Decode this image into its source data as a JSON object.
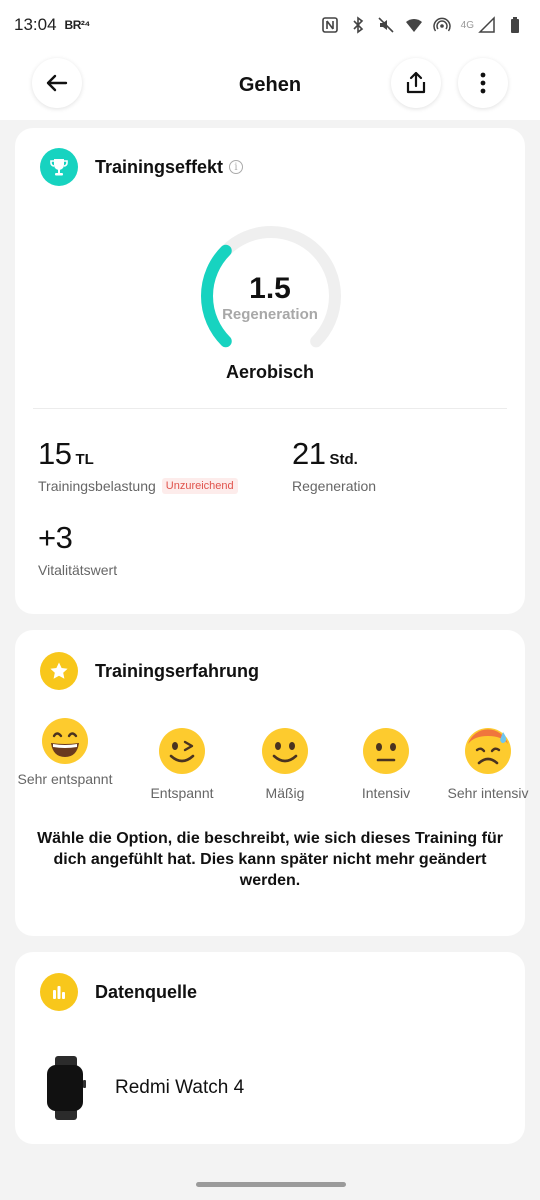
{
  "status_bar": {
    "time": "13:04",
    "carrier_icon_text": "BR²⁴",
    "network": "4G",
    "icons": [
      "nfc-icon",
      "bluetooth-icon",
      "mute-icon",
      "wifi-icon",
      "hotspot-icon",
      "signal-icon",
      "battery-icon"
    ]
  },
  "header": {
    "title": "Gehen",
    "back_icon": "arrow-left-icon",
    "share_icon": "share-icon",
    "more_icon": "more-vertical-icon"
  },
  "training_effect": {
    "title": "Trainingseffekt",
    "value": "1.5",
    "value_label": "Regeneration",
    "type": "Aerobisch",
    "gauge_level_fraction": 0.25,
    "accent_color": "#17d3c0",
    "stats": {
      "load_value": "15",
      "load_unit": "TL",
      "load_label": "Trainingsbelastung",
      "load_badge": "Unzureichend",
      "regen_value": "21",
      "regen_unit": "Std.",
      "regen_label": "Regeneration",
      "vitality_value": "+3",
      "vitality_label": "Vitalitätswert"
    }
  },
  "training_experience": {
    "title": "Trainingserfahrung",
    "options": [
      {
        "label": "Sehr entspannt",
        "icon": "grinning-face-icon"
      },
      {
        "label": "Entspannt",
        "icon": "winking-face-icon"
      },
      {
        "label": "Mäßig",
        "icon": "smiling-face-icon"
      },
      {
        "label": "Intensiv",
        "icon": "neutral-face-icon"
      },
      {
        "label": "Sehr intensiv",
        "icon": "sweating-face-icon"
      }
    ],
    "note": "Wähle die Option, die beschreibt, wie sich dieses Training für dich angefühlt hat. Dies kann später nicht mehr geändert werden."
  },
  "data_source": {
    "title": "Datenquelle",
    "device_name": "Redmi Watch 4"
  },
  "colors": {
    "teal": "#17d3c0",
    "yellow": "#f8c71b",
    "badge_red": "#e0524b"
  }
}
